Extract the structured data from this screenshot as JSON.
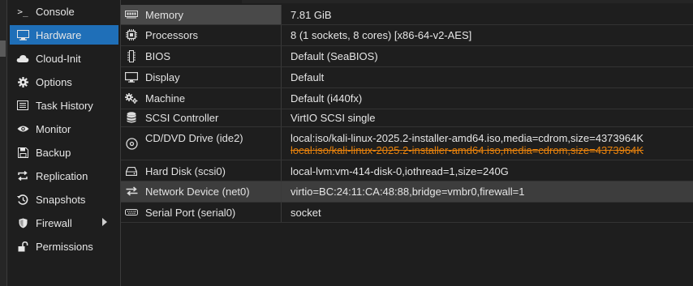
{
  "sidebar": {
    "items": [
      {
        "label": "Console",
        "icon": "console-icon",
        "glyph": ">_"
      },
      {
        "label": "Hardware",
        "icon": "monitor-icon",
        "active": true
      },
      {
        "label": "Cloud-Init",
        "icon": "cloud-icon"
      },
      {
        "label": "Options",
        "icon": "gear-icon"
      },
      {
        "label": "Task History",
        "icon": "list-icon"
      },
      {
        "label": "Monitor",
        "icon": "eye-icon"
      },
      {
        "label": "Backup",
        "icon": "floppy-icon"
      },
      {
        "label": "Replication",
        "icon": "replication-icon"
      },
      {
        "label": "Snapshots",
        "icon": "history-icon"
      },
      {
        "label": "Firewall",
        "icon": "shield-icon"
      },
      {
        "label": "Permissions",
        "icon": "unlock-icon"
      }
    ]
  },
  "hardware": {
    "rows": [
      {
        "key": "Memory",
        "value": "7.81 GiB",
        "icon": "memory-icon"
      },
      {
        "key": "Processors",
        "value": "8 (1 sockets, 8 cores) [x86-64-v2-AES]",
        "icon": "cpu-icon"
      },
      {
        "key": "BIOS",
        "value": "Default (SeaBIOS)",
        "icon": "bios-icon"
      },
      {
        "key": "Display",
        "value": "Default",
        "icon": "display-icon"
      },
      {
        "key": "Machine",
        "value": "Default (i440fx)",
        "icon": "machine-icon"
      },
      {
        "key": "SCSI Controller",
        "value": "VirtIO SCSI single",
        "icon": "database-icon"
      },
      {
        "key": "CD/DVD Drive (ide2)",
        "value": "local:iso/kali-linux-2025.2-installer-amd64.iso,media=cdrom,size=4373964K",
        "pending_value": "local:iso/kali-linux-2025.2-installer-amd64.iso,media=cdrom,size=4373964K",
        "icon": "cdrom-icon"
      },
      {
        "key": "Hard Disk (scsi0)",
        "value": "local-lvm:vm-414-disk-0,iothread=1,size=240G",
        "icon": "hdd-icon"
      },
      {
        "key": "Network Device (net0)",
        "value": "virtio=BC:24:11:CA:48:88,bridge=vmbr0,firewall=1",
        "icon": "network-icon"
      },
      {
        "key": "Serial Port (serial0)",
        "value": "socket",
        "icon": "serial-port-icon"
      }
    ]
  },
  "colors": {
    "accent": "#1f6fb8",
    "pending": "#e8820c"
  }
}
